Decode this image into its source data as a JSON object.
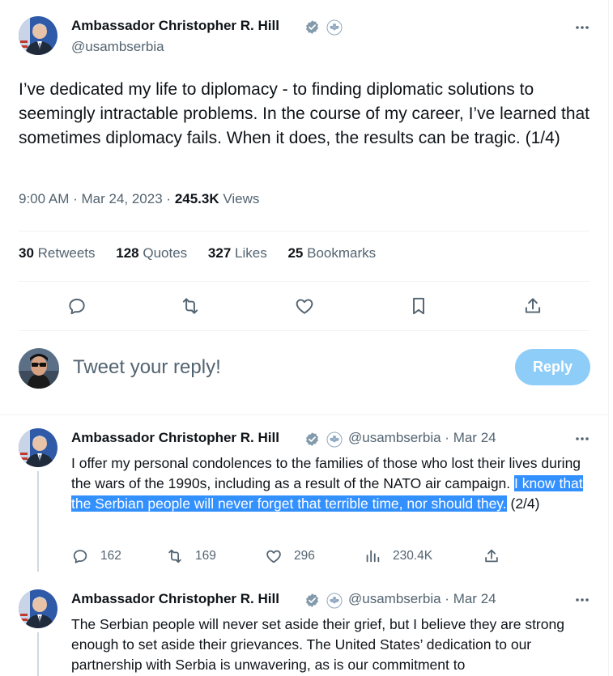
{
  "main_tweet": {
    "author_name": "Ambassador Christopher R. Hill",
    "handle": "@usambserbia",
    "text": "I’ve dedicated my life to diplomacy - to finding diplomatic solutions to seemingly intractable problems. In the course of my career, I’ve learned that sometimes diplomacy fails.  When it does, the results can be tragic. (1/4)",
    "time": "9:00 AM",
    "date": "Mar 24, 2023",
    "views_count": "245.3K",
    "views_label": "Views",
    "stats": {
      "retweets": {
        "count": "30",
        "label": "Retweets"
      },
      "quotes": {
        "count": "128",
        "label": "Quotes"
      },
      "likes": {
        "count": "327",
        "label": "Likes"
      },
      "bookmarks": {
        "count": "25",
        "label": "Bookmarks"
      }
    }
  },
  "composer": {
    "placeholder": "Tweet your reply!",
    "button_label": "Reply"
  },
  "replies": [
    {
      "author_name": "Ambassador Christopher R. Hill",
      "handle_date": "@usambserbia · Mar 24",
      "text_before": "I offer my personal condolences to the families of those who lost their lives during the wars of the 1990s, including as a result of the NATO air campaign. ",
      "text_highlight": "I know that the Serbian people will never forget that terrible time, nor should they.",
      "text_after": " (2/4)",
      "replies_count": "162",
      "retweets_count": "169",
      "likes_count": "296",
      "views_count": "230.4K"
    },
    {
      "author_name": "Ambassador Christopher R. Hill",
      "handle_date": "@usambserbia · Mar 24",
      "text": "The Serbian people will never set aside their grief, but I believe they are strong enough to set aside their grievances. The United States’ dedication to our partnership with Serbia is unwavering, as is our commitment to"
    }
  ],
  "colors": {
    "accent": "#1d9bf0",
    "reply_button": "#8ecdf8",
    "highlight": "#3390ff",
    "secondary_text": "#536471",
    "verified_badge": "#829aab"
  },
  "icons": [
    "verified-badge-icon",
    "seal-icon",
    "more-icon",
    "reply-icon",
    "retweet-icon",
    "like-icon",
    "bookmark-icon",
    "share-icon",
    "views-icon"
  ]
}
